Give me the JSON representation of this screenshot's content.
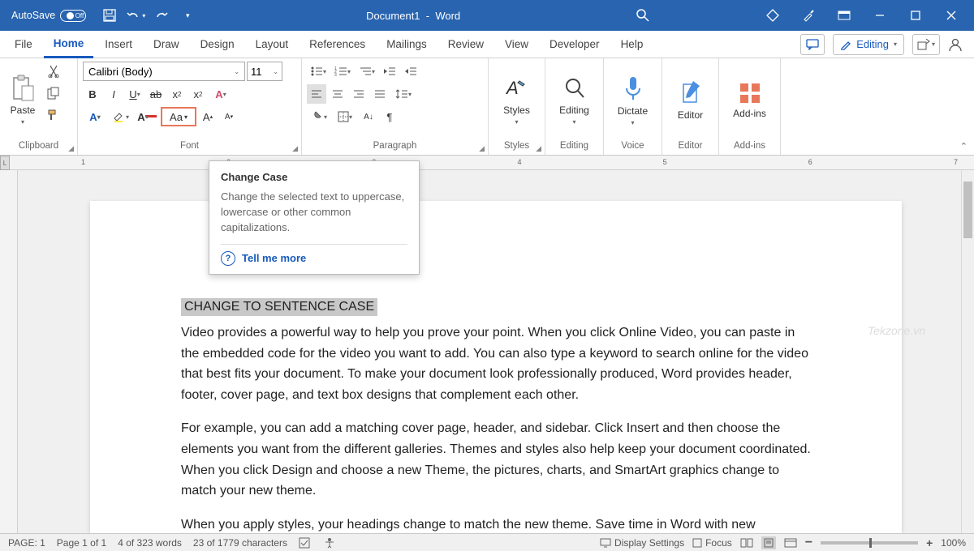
{
  "titlebar": {
    "autosave": "AutoSave",
    "autosave_state": "Off",
    "doc": "Document1",
    "app": "Word"
  },
  "tabs": [
    "File",
    "Home",
    "Insert",
    "Draw",
    "Design",
    "Layout",
    "References",
    "Mailings",
    "Review",
    "View",
    "Developer",
    "Help"
  ],
  "active_tab": "Home",
  "editing_mode": "Editing",
  "ribbon": {
    "clipboard": {
      "paste": "Paste",
      "label": "Clipboard"
    },
    "font": {
      "label": "Font",
      "name": "Calibri (Body)",
      "size": "11",
      "change_case": "Aa"
    },
    "paragraph": {
      "label": "Paragraph"
    },
    "styles": {
      "btn": "Styles",
      "label": "Styles"
    },
    "editing": {
      "btn": "Editing",
      "label": "Editing"
    },
    "voice": {
      "btn": "Dictate",
      "label": "Voice"
    },
    "editor": {
      "btn": "Editor",
      "label": "Editor"
    },
    "addins": {
      "btn": "Add-ins",
      "label": "Add-ins"
    }
  },
  "tooltip": {
    "title": "Change Case",
    "body": "Change the selected text to uppercase, lowercase or other common capitalizations.",
    "more": "Tell me more"
  },
  "doc": {
    "selected": "CHANGE TO SENTENCE CASE",
    "p1": "Video provides a powerful way to help you prove your point. When you click Online Video, you can paste in the embedded code for the video you want to add. You can also type a keyword to search online for the video that best fits your document. To make your document look professionally produced, Word provides header, footer, cover page, and text box designs that complement each other.",
    "p2": "For example, you can add a matching cover page, header, and sidebar. Click Insert and then choose the elements you want from the different galleries. Themes and styles also help keep your document coordinated. When you click Design and choose a new Theme, the pictures, charts, and SmartArt graphics change to match your new theme.",
    "p3": "When you apply styles, your headings change to match the new theme. Save time in Word with new"
  },
  "status": {
    "page_short": "PAGE: 1",
    "page": "Page 1 of 1",
    "words": "4 of 323 words",
    "chars": "23 of 1779 characters",
    "display": "Display Settings",
    "focus": "Focus",
    "zoom": "100%"
  },
  "ruler_marks": [
    "1",
    "2",
    "3",
    "4",
    "5",
    "6",
    "7"
  ],
  "watermark": "Tekzone.vn"
}
